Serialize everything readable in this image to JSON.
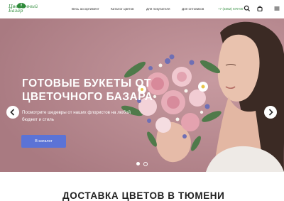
{
  "brand": {
    "logo_text": "Цветочный Базар",
    "accent_color": "#2e8b3a"
  },
  "nav": {
    "items": [
      {
        "label": "Весь ассортимент"
      },
      {
        "label": "Каталог цветов"
      },
      {
        "label": "Для покупателя"
      },
      {
        "label": "Для оптовиков"
      }
    ],
    "phone": "+7 (3452) 579-00"
  },
  "header_icons": [
    "search-icon",
    "cart-icon",
    "menu-icon"
  ],
  "hero": {
    "title": "ГОТОВЫЕ БУКЕТЫ ОТ ЦВЕТОЧНОГО БАЗАРА",
    "subtitle": "Посмотрите шедевры от наших флористов на любой бюджет и стиль",
    "cta_label": "В каталог",
    "cta_color": "#5b73d6",
    "background_color": "#b5888e",
    "slides_total": 2,
    "active_slide": 1
  },
  "section": {
    "title": "ДОСТАВКА ЦВЕТОВ В ТЮМЕНИ"
  }
}
